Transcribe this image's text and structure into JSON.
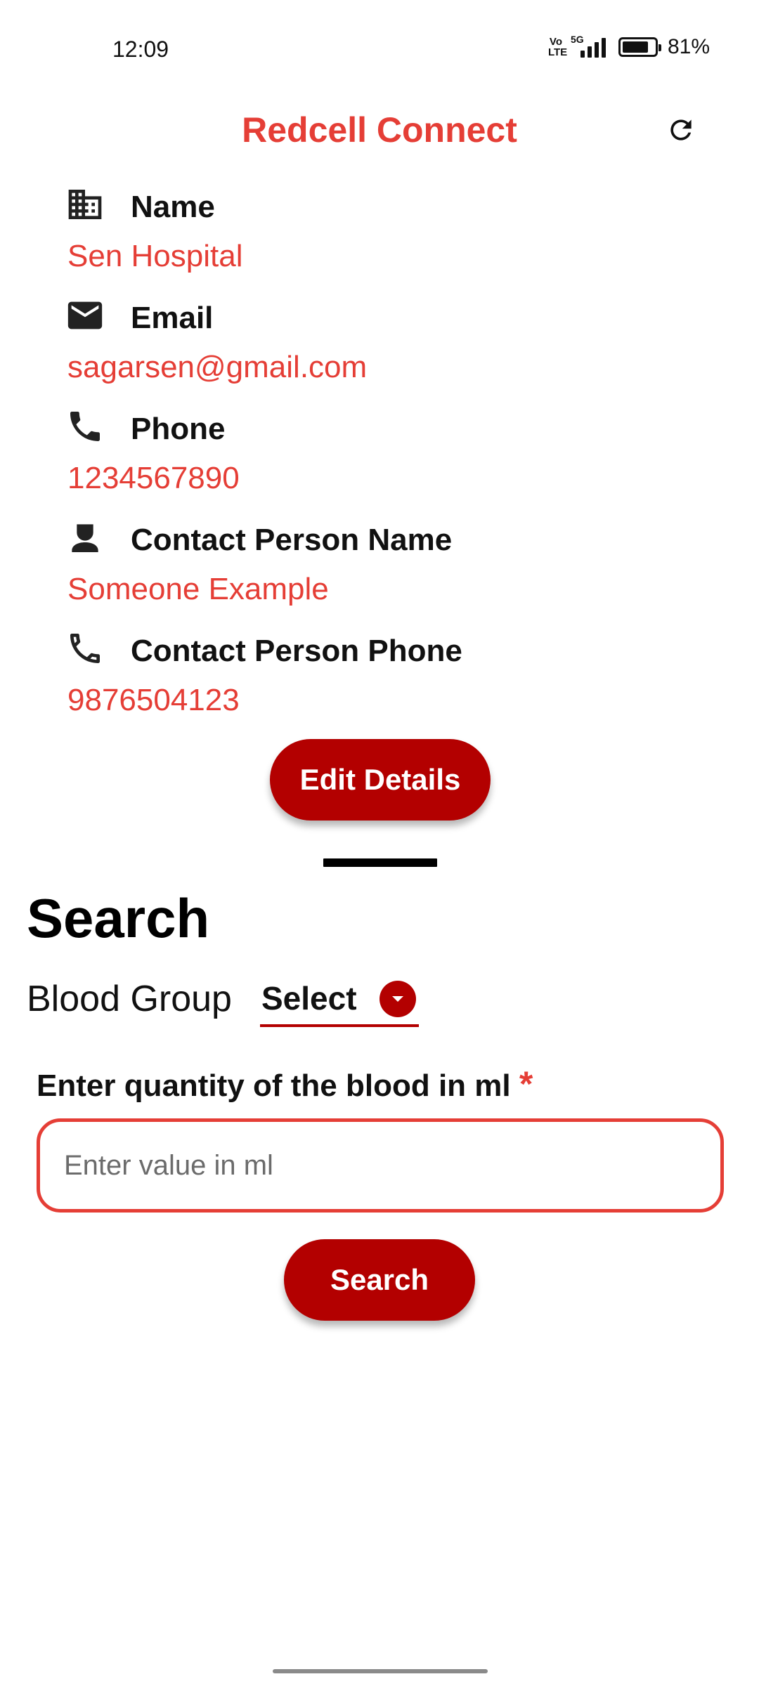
{
  "status_bar": {
    "time": "12:09",
    "volte_top": "Vo",
    "volte_bottom": "LTE",
    "network": "5G",
    "battery_percent_text": "81%",
    "battery_level": 0.81
  },
  "app_bar": {
    "title": "Redcell Connect",
    "refresh_icon": "refresh-icon"
  },
  "profile": {
    "fields": [
      {
        "label": "Name",
        "value": "Sen Hospital",
        "icon": "building-icon"
      },
      {
        "label": "Email",
        "value": "sagarsen@gmail.com",
        "icon": "email-icon"
      },
      {
        "label": "Phone",
        "value": "1234567890",
        "icon": "phone-icon"
      },
      {
        "label": "Contact Person Name",
        "value": "Someone Example",
        "icon": "person-icon"
      },
      {
        "label": "Contact Person Phone",
        "value": "9876504123",
        "icon": "phone-outline-icon"
      }
    ],
    "edit_button": "Edit Details"
  },
  "search": {
    "title": "Search",
    "blood_group_label": "Blood Group",
    "blood_group_selected": "Select",
    "quantity_label": "Enter quantity of the blood in ml",
    "required_marker": "*",
    "quantity_placeholder": "Enter value in ml",
    "quantity_value": "",
    "search_button": "Search"
  },
  "colors": {
    "accent_red": "#e53e36",
    "button_red": "#b30000"
  }
}
